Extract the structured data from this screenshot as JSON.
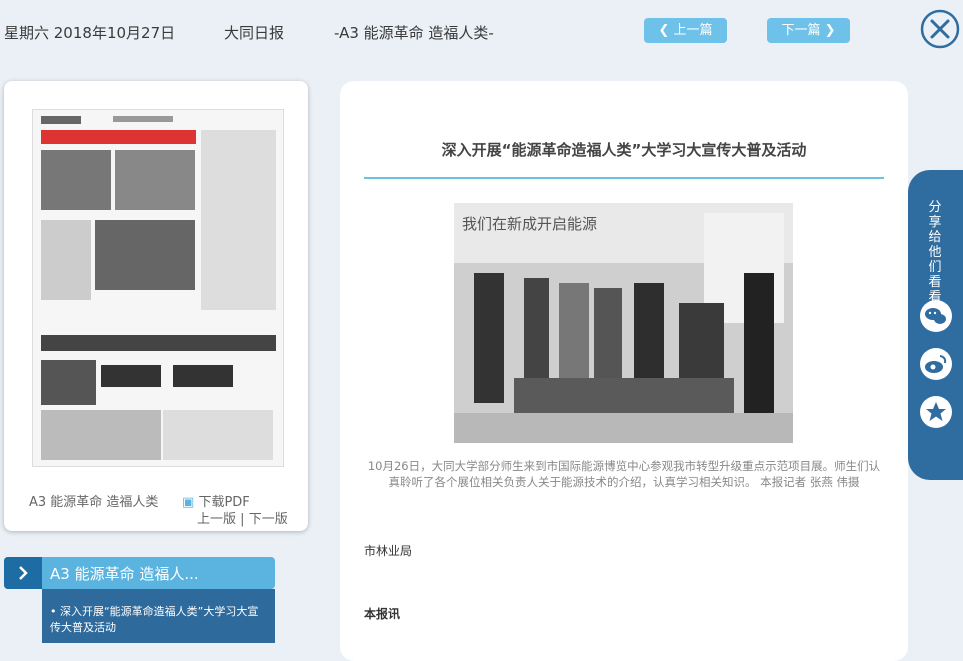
{
  "header": {
    "date": "星期六 2018年10月27日",
    "paper_name": "大同日报",
    "edition": "-A3 能源革命 造福人类-",
    "prev_label": "上一篇",
    "next_label": "下一篇"
  },
  "sidebar": {
    "thumbnail_section": "A3 能源革命 造福人类",
    "download_label": "下载PDF",
    "prev_edition": "上一版",
    "separator": "|",
    "next_edition": "下一版",
    "edition_tab_label": "A3 能源革命 造福人...",
    "articles": [
      "• 深入开展“能源革命造福人类”大学习大宣传大普及活动"
    ]
  },
  "article": {
    "title": "深入开展“能源革命造福人类”大学习大宣传大普及活动",
    "photo_sign_text": "我们在新成开启能源",
    "caption": "10月26日，大同大学部分师生来到市国际能源博览中心参观我市转型升级重点示范项目展。师生们认真聆听了各个展位相关负责人关于能源技术的介绍，认真学习相关知识。 本报记者 张燕 伟摄",
    "byline_source": "市林业局",
    "byline_label": "本报讯"
  },
  "share": {
    "label": "分享给他们看看",
    "icons": [
      "wechat-icon",
      "weibo-icon",
      "qzone-icon"
    ]
  },
  "colors": {
    "accent": "#6ec1e8",
    "dark_blue": "#2f6c9f",
    "background": "#eaf0f5"
  }
}
